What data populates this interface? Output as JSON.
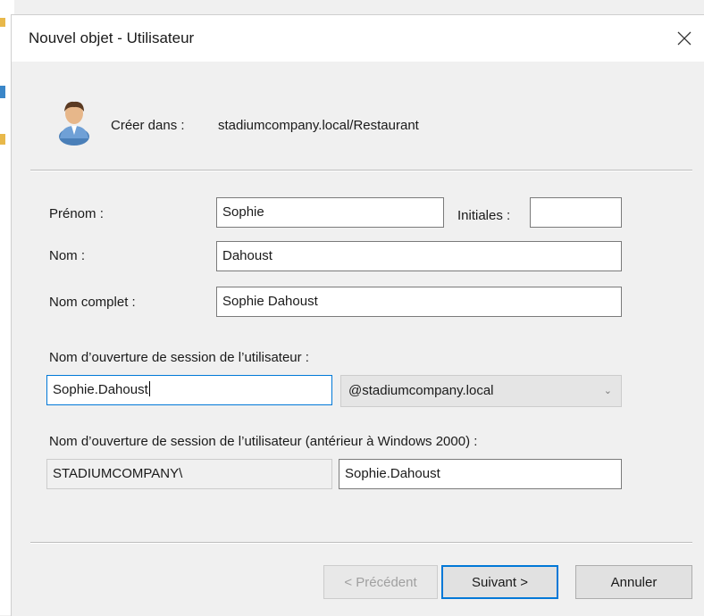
{
  "dialog": {
    "title": "Nouvel objet - Utilisateur",
    "create_in_label": "Créer dans :",
    "create_in_value": "stadiumcompany.local/Restaurant"
  },
  "fields": {
    "first_name_label": "Prénom :",
    "first_name_value": "Sophie",
    "initials_label": "Initiales :",
    "initials_value": "",
    "last_name_label": "Nom :",
    "last_name_value": "Dahoust",
    "full_name_label": "Nom complet :",
    "full_name_value": "Sophie Dahoust",
    "logon_label": "Nom d’ouverture de session de l’utilisateur :",
    "logon_value": "Sophie.Dahoust",
    "domain_suffix": "@stadiumcompany.local",
    "logon_pre2000_label": "Nom d’ouverture de session de l’utilisateur (antérieur à Windows 2000) :",
    "netbios_domain": "STADIUMCOMPANY\\",
    "logon_pre2000_value": "Sophie.Dahoust"
  },
  "buttons": {
    "previous": "< Précédent",
    "next": "Suivant >",
    "cancel": "Annuler"
  },
  "icons": {
    "close": "close-icon",
    "user": "user-icon",
    "dropdown": "chevron-down-icon"
  },
  "colors": {
    "focus_border": "#0078d7",
    "dialog_bg": "#f0f0f0"
  }
}
